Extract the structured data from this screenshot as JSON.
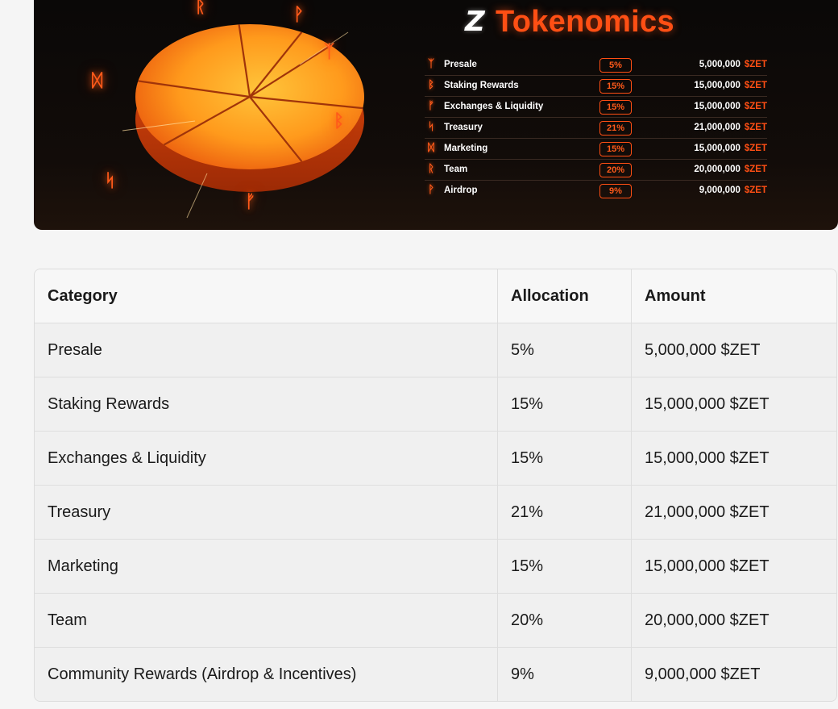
{
  "banner": {
    "title": "Tokenomics",
    "logo_glyph": "Z",
    "rows": [
      {
        "icon": "ᛉ",
        "name": "Presale",
        "pct": "5%",
        "amount": "5,000,000",
        "ticker": "$ZET"
      },
      {
        "icon": "ᛒ",
        "name": "Staking Rewards",
        "pct": "15%",
        "amount": "15,000,000",
        "ticker": "$ZET"
      },
      {
        "icon": "ᚠ",
        "name": "Exchanges & Liquidity",
        "pct": "15%",
        "amount": "15,000,000",
        "ticker": "$ZET"
      },
      {
        "icon": "ᛋ",
        "name": "Treasury",
        "pct": "21%",
        "amount": "21,000,000",
        "ticker": "$ZET"
      },
      {
        "icon": "ᛞ",
        "name": "Marketing",
        "pct": "15%",
        "amount": "15,000,000",
        "ticker": "$ZET"
      },
      {
        "icon": "ᚱ",
        "name": "Team",
        "pct": "20%",
        "amount": "20,000,000",
        "ticker": "$ZET"
      },
      {
        "icon": "ᚹ",
        "name": "Airdrop",
        "pct": "9%",
        "amount": "9,000,000",
        "ticker": "$ZET"
      }
    ],
    "runes": [
      "ᚱ",
      "ᚹ",
      "ᛉ",
      "ᛞ",
      "ᛒ",
      "ᛋ",
      "ᚠ"
    ],
    "colors": {
      "accent": "#ff4f14",
      "pie_light": "#ffb020",
      "pie_dark": "#e24a0c"
    }
  },
  "table": {
    "headers": [
      "Category",
      "Allocation",
      "Amount"
    ],
    "rows": [
      [
        "Presale",
        "5%",
        "5,000,000 $ZET"
      ],
      [
        "Staking Rewards",
        "15%",
        "15,000,000 $ZET"
      ],
      [
        "Exchanges & Liquidity",
        "15%",
        "15,000,000 $ZET"
      ],
      [
        "Treasury",
        "21%",
        "21,000,000 $ZET"
      ],
      [
        "Marketing",
        "15%",
        "15,000,000 $ZET"
      ],
      [
        "Team",
        "20%",
        "20,000,000 $ZET"
      ],
      [
        "Community Rewards (Airdrop & Incentives)",
        "9%",
        "9,000,000 $ZET"
      ]
    ]
  }
}
